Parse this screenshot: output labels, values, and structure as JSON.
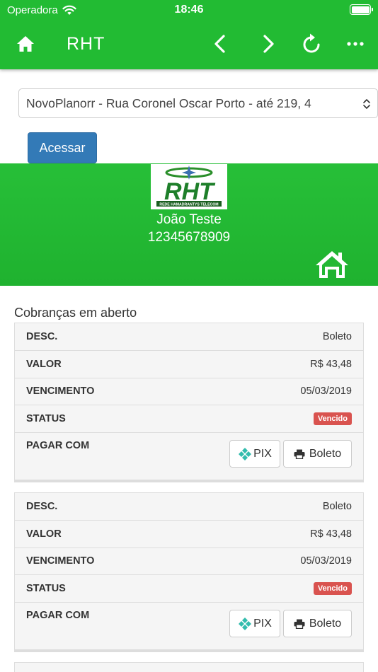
{
  "status_bar": {
    "carrier": "Operadora",
    "time": "18:46"
  },
  "nav": {
    "title": "RHT"
  },
  "location_select": {
    "selected": "NovoPlanorr - Rua Coronel Oscar Porto - até 219, 4"
  },
  "access_button": "Acessar",
  "profile": {
    "logo_text": "RHT",
    "logo_subtext": "REDE HAMADRANTYS TELECOM",
    "name": "João Teste",
    "cpf": "12345678909"
  },
  "section_title": "Cobranças em aberto",
  "labels": {
    "desc": "DESC.",
    "valor": "VALOR",
    "vencimento": "VENCIMENTO",
    "status": "STATUS",
    "pagar_com": "PAGAR COM",
    "pix": "PIX",
    "boleto": "Boleto"
  },
  "charges": [
    {
      "desc": "Boleto",
      "valor": "R$ 43,48",
      "vencimento": "05/03/2019",
      "status": "Vencido"
    },
    {
      "desc": "Boleto",
      "valor": "R$ 43,48",
      "vencimento": "05/03/2019",
      "status": "Vencido"
    }
  ],
  "colors": {
    "brand_green": "#22bb33",
    "primary_blue": "#337ab7",
    "danger_red": "#d9534f",
    "pix_teal": "#32bcad"
  },
  "icons": [
    "home-icon",
    "chevron-left-icon",
    "chevron-right-icon",
    "reload-icon",
    "more-icon",
    "wifi-icon",
    "battery-icon",
    "pix-icon",
    "printer-icon",
    "select-arrows-icon"
  ]
}
